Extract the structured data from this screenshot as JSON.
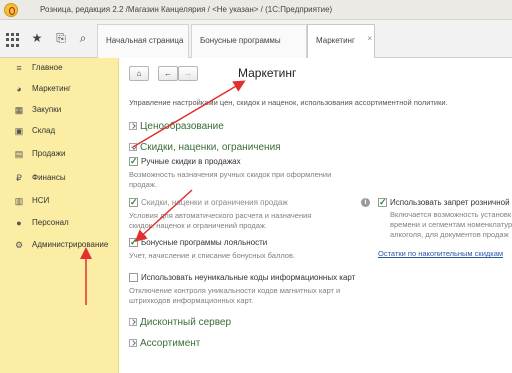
{
  "titlebar": {
    "title": "Розница, редакция 2.2 /Магазин Канцелярия / <Не указан> / (1С:Предприятие)"
  },
  "tabs": [
    {
      "label": "Начальная страница"
    },
    {
      "label": "Бонусные программы"
    },
    {
      "label": "Маркетинг",
      "close": "×"
    }
  ],
  "sidebar": {
    "items": [
      {
        "label": "Главное",
        "icon": "≡"
      },
      {
        "label": "Маркетинг",
        "icon": "◕"
      },
      {
        "label": "Закупки",
        "icon": "▦"
      },
      {
        "label": "Склад",
        "icon": "▣"
      },
      {
        "label": "Продажи",
        "icon": "▤"
      },
      {
        "label": "Финансы",
        "icon": "₽"
      },
      {
        "label": "НСИ",
        "icon": "▥"
      },
      {
        "label": "Персонал",
        "icon": "●"
      },
      {
        "label": "Администрирование",
        "icon": "⚙"
      }
    ]
  },
  "toolbar": {
    "home": "⌂",
    "back": "←",
    "forward": "→"
  },
  "page": {
    "title": "Маркетинг",
    "description": "Управление настройками цен, скидок и наценок, использования ассортиментной политики."
  },
  "sections": {
    "pricing": "Ценообразование",
    "discounts": "Скидки, наценки, ограничения",
    "discount_server": "Дисконтный сервер",
    "assortment": "Ассортимент"
  },
  "options": {
    "manual": {
      "label": "Ручные скидки в продажах",
      "hint1": "Возможность назначения ручных скидок при оформлении",
      "hint2": "продаж."
    },
    "auto": {
      "label": "Скидки, наценки и ограничения продаж",
      "hint1": "Условия для автоматического расчета и назначения",
      "hint2": "скидок, наценок и ограничений продаж."
    },
    "bonus": {
      "label": "Бонусные программы лояльности",
      "hint1": "Учет, начисление и списание бонусных баллов."
    },
    "cards": {
      "label": "Использовать неуникальные коды информационных карт",
      "hint1": "Отключение контроля уникальности кодов магнитных карт и",
      "hint2": "штрихкодов информационных карт."
    },
    "ban": {
      "label": "Использовать запрет розничной",
      "hint1": "Включается возможность установк",
      "hint2": "времени и сегментам номенклатур",
      "hint3": "алкоголя, для документов продаж",
      "link": "Остатки по накопительным скидкам",
      "info": "i"
    }
  },
  "colors": {
    "sidebar_bg": "#fbeda4",
    "section_green": "#3a6d3a",
    "arrow_red": "#e03030"
  }
}
